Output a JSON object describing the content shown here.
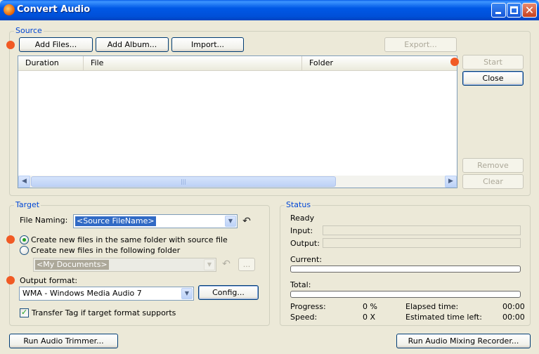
{
  "window": {
    "title": "Convert Audio",
    "controls": {
      "minimize": "minimize",
      "maximize": "maximize",
      "close": "✕"
    }
  },
  "source": {
    "group_label": "Source",
    "add_files": "Add Files...",
    "add_album": "Add Album...",
    "import": "Import...",
    "export": "Export...",
    "columns": [
      "Duration",
      "File",
      "Folder"
    ],
    "scroll_left": "◀",
    "scroll_right": "▶",
    "scroll_grip": "|||"
  },
  "side_buttons": {
    "start": "Start",
    "close": "Close",
    "remove": "Remove",
    "clear": "Clear"
  },
  "target": {
    "group_label": "Target",
    "file_naming_label": "File Naming:",
    "file_naming_value": "<Source FileName>",
    "radio_same_folder": "Create new files in the same folder with source file",
    "radio_following_folder": "Create new files in the following folder",
    "folder_value": "<My Documents>",
    "browse": "...",
    "output_format_label": "Output format:",
    "output_format_value": "WMA - Windows Media Audio 7",
    "config": "Config...",
    "transfer_tag": "Transfer Tag if target format supports",
    "undo_glyph": "↶",
    "dropdown_glyph": "▼"
  },
  "status": {
    "group_label": "Status",
    "state": "Ready",
    "input_label": "Input:",
    "output_label": "Output:",
    "current_label": "Current:",
    "current_progress": 0,
    "total_label": "Total:",
    "total_progress": 0,
    "progress_label": "Progress:",
    "progress_value": "0 %",
    "speed_label": "Speed:",
    "speed_value": "0 X",
    "elapsed_label": "Elapsed time:",
    "elapsed_value": "00:00",
    "remaining_label": "Estimated time left:",
    "remaining_value": "00:00"
  },
  "bottom": {
    "trimmer": "Run Audio Trimmer...",
    "mixing": "Run Audio Mixing Recorder..."
  },
  "colors": {
    "marker": "#F15A24",
    "group_title": "#0046D5",
    "titlebar": "#0058E6"
  }
}
